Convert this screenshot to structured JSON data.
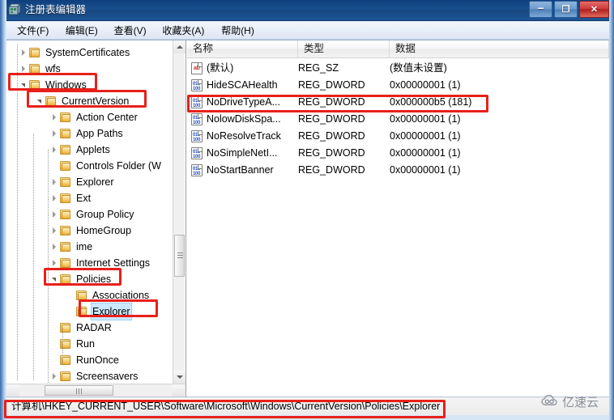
{
  "window": {
    "title": "注册表编辑器",
    "icon": "registry-editor-icon",
    "controls": {
      "minimize": "–",
      "maximize": "❐",
      "close": "✕"
    }
  },
  "menubar": {
    "items": [
      {
        "label": "文件(F)",
        "name": "menu-file"
      },
      {
        "label": "编辑(E)",
        "name": "menu-edit"
      },
      {
        "label": "查看(V)",
        "name": "menu-view"
      },
      {
        "label": "收藏夹(A)",
        "name": "menu-favorites"
      },
      {
        "label": "帮助(H)",
        "name": "menu-help"
      }
    ]
  },
  "tree": {
    "items": [
      {
        "label": "SystemCertificates",
        "depth": 1,
        "state": "collapsed",
        "selected": false,
        "annotated": false
      },
      {
        "label": "wfs",
        "depth": 1,
        "state": "collapsed",
        "selected": false,
        "annotated": false
      },
      {
        "label": "Windows",
        "depth": 1,
        "state": "expanded",
        "selected": false,
        "annotated": true
      },
      {
        "label": "CurrentVersion",
        "depth": 2,
        "state": "expanded",
        "selected": false,
        "annotated": true
      },
      {
        "label": "Action Center",
        "depth": 3,
        "state": "collapsed",
        "selected": false,
        "annotated": false
      },
      {
        "label": "App Paths",
        "depth": 3,
        "state": "collapsed",
        "selected": false,
        "annotated": false
      },
      {
        "label": "Applets",
        "depth": 3,
        "state": "collapsed",
        "selected": false,
        "annotated": false
      },
      {
        "label": "Controls Folder (W",
        "depth": 3,
        "state": "leaf",
        "selected": false,
        "annotated": false
      },
      {
        "label": "Explorer",
        "depth": 3,
        "state": "collapsed",
        "selected": false,
        "annotated": false
      },
      {
        "label": "Ext",
        "depth": 3,
        "state": "collapsed",
        "selected": false,
        "annotated": false
      },
      {
        "label": "Group Policy",
        "depth": 3,
        "state": "collapsed",
        "selected": false,
        "annotated": false
      },
      {
        "label": "HomeGroup",
        "depth": 3,
        "state": "collapsed",
        "selected": false,
        "annotated": false
      },
      {
        "label": "ime",
        "depth": 3,
        "state": "collapsed",
        "selected": false,
        "annotated": false
      },
      {
        "label": "Internet Settings",
        "depth": 3,
        "state": "collapsed",
        "selected": false,
        "annotated": false
      },
      {
        "label": "Policies",
        "depth": 3,
        "state": "expanded",
        "selected": false,
        "annotated": true
      },
      {
        "label": "Associations",
        "depth": 4,
        "state": "leaf",
        "selected": false,
        "annotated": false
      },
      {
        "label": "Explorer",
        "depth": 4,
        "state": "leaf",
        "selected": true,
        "annotated": true
      },
      {
        "label": "RADAR",
        "depth": 3,
        "state": "leaf",
        "selected": false,
        "annotated": false
      },
      {
        "label": "Run",
        "depth": 3,
        "state": "leaf",
        "selected": false,
        "annotated": false
      },
      {
        "label": "RunOnce",
        "depth": 3,
        "state": "leaf",
        "selected": false,
        "annotated": false
      },
      {
        "label": "Screensavers",
        "depth": 3,
        "state": "collapsed",
        "selected": false,
        "annotated": false
      }
    ]
  },
  "list": {
    "columns": [
      {
        "label": "名称",
        "name": "column-name"
      },
      {
        "label": "类型",
        "name": "column-type"
      },
      {
        "label": "数据",
        "name": "column-data"
      }
    ],
    "rows": [
      {
        "name": "(默认)",
        "type": "REG_SZ",
        "data": "(数值未设置)",
        "icon": "string-value-icon",
        "icon_text": "ab",
        "icon_kind": "sz",
        "annotated": false
      },
      {
        "name": "HideSCAHealth",
        "type": "REG_DWORD",
        "data": "0x00000001 (1)",
        "icon": "dword-value-icon",
        "icon_text": "011\n100",
        "icon_kind": "dword",
        "annotated": false
      },
      {
        "name": "NoDriveTypeA...",
        "type": "REG_DWORD",
        "data": "0x000000b5 (181)",
        "icon": "dword-value-icon",
        "icon_text": "011\n100",
        "icon_kind": "dword",
        "annotated": true
      },
      {
        "name": "NolowDiskSpa...",
        "type": "REG_DWORD",
        "data": "0x00000001 (1)",
        "icon": "dword-value-icon",
        "icon_text": "011\n100",
        "icon_kind": "dword",
        "annotated": false
      },
      {
        "name": "NoResolveTrack",
        "type": "REG_DWORD",
        "data": "0x00000001 (1)",
        "icon": "dword-value-icon",
        "icon_text": "011\n100",
        "icon_kind": "dword",
        "annotated": false
      },
      {
        "name": "NoSimpleNetI...",
        "type": "REG_DWORD",
        "data": "0x00000001 (1)",
        "icon": "dword-value-icon",
        "icon_text": "011\n100",
        "icon_kind": "dword",
        "annotated": false
      },
      {
        "name": "NoStartBanner",
        "type": "REG_DWORD",
        "data": "0x00000001 (1)",
        "icon": "dword-value-icon",
        "icon_text": "011\n100",
        "icon_kind": "dword",
        "annotated": false
      }
    ]
  },
  "statusbar": {
    "path": "计算机\\HKEY_CURRENT_USER\\Software\\Microsoft\\Windows\\CurrentVersion\\Policies\\Explorer"
  },
  "watermark": {
    "text": "亿速云",
    "icon": "cloud-logo-icon"
  },
  "colors": {
    "annotation": "#e8201a",
    "titlebar": "#1a4f8e",
    "selection": "#cce8ff",
    "close_button": "#cf3b3b"
  }
}
